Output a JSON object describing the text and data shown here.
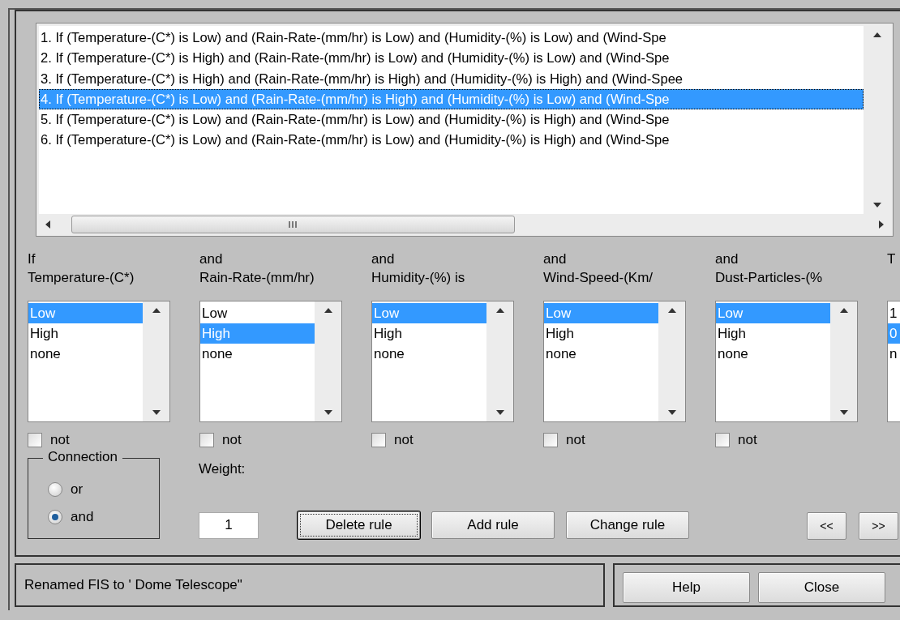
{
  "rules": [
    {
      "text": "1. If (Temperature-(C*) is Low) and (Rain-Rate-(mm/hr) is Low) and (Humidity-(%) is Low) and (Wind-Spe",
      "selected": false
    },
    {
      "text": "2. If (Temperature-(C*) is High) and (Rain-Rate-(mm/hr) is Low) and (Humidity-(%) is Low) and (Wind-Spe",
      "selected": false
    },
    {
      "text": "3. If (Temperature-(C*) is High) and (Rain-Rate-(mm/hr) is High) and (Humidity-(%) is High) and (Wind-Spee",
      "selected": false
    },
    {
      "text": "4. If (Temperature-(C*) is Low) and (Rain-Rate-(mm/hr) is High) and (Humidity-(%) is Low) and (Wind-Spe",
      "selected": true
    },
    {
      "text": "5. If (Temperature-(C*) is Low) and (Rain-Rate-(mm/hr) is Low) and (Humidity-(%) is High) and (Wind-Spe",
      "selected": false
    },
    {
      "text": "6. If (Temperature-(C*) is Low) and (Rain-Rate-(mm/hr) is Low) and (Humidity-(%) is High) and (Wind-Spe",
      "selected": false
    }
  ],
  "columns": [
    {
      "kind": "input",
      "prefix": "If",
      "variable": "Temperature-(C*)",
      "options": [
        {
          "label": "Low",
          "selected": true
        },
        {
          "label": "High",
          "selected": false
        },
        {
          "label": "none",
          "selected": false
        }
      ],
      "not_label": "not",
      "not": false
    },
    {
      "kind": "input",
      "prefix": "and",
      "variable": "Rain-Rate-(mm/hr)",
      "options": [
        {
          "label": "Low",
          "selected": false
        },
        {
          "label": "High",
          "selected": true
        },
        {
          "label": "none",
          "selected": false
        }
      ],
      "not_label": "not",
      "not": false
    },
    {
      "kind": "input",
      "prefix": "and",
      "variable": "Humidity-(%) is",
      "options": [
        {
          "label": "Low",
          "selected": true
        },
        {
          "label": "High",
          "selected": false
        },
        {
          "label": "none",
          "selected": false
        }
      ],
      "not_label": "not",
      "not": false
    },
    {
      "kind": "input",
      "prefix": "and",
      "variable": "Wind-Speed-(Km/",
      "options": [
        {
          "label": "Low",
          "selected": true
        },
        {
          "label": "High",
          "selected": false
        },
        {
          "label": "none",
          "selected": false
        }
      ],
      "not_label": "not",
      "not": false
    },
    {
      "kind": "input",
      "prefix": "and",
      "variable": "Dust-Particles-(%",
      "options": [
        {
          "label": "Low",
          "selected": true
        },
        {
          "label": "High",
          "selected": false
        },
        {
          "label": "none",
          "selected": false
        }
      ],
      "not_label": "not",
      "not": false
    },
    {
      "kind": "partial",
      "prefix": "T",
      "options": [
        {
          "label": "1",
          "selected": false
        },
        {
          "label": "0",
          "selected": true
        },
        {
          "label": "n",
          "selected": false
        }
      ]
    }
  ],
  "connection": {
    "title": "Connection",
    "options": [
      {
        "label": "or",
        "selected": false
      },
      {
        "label": "and",
        "selected": true
      }
    ]
  },
  "weight": {
    "label": "Weight:",
    "value": "1"
  },
  "buttons": [
    {
      "label": "Delete rule",
      "focused": true
    },
    {
      "label": "Add rule",
      "focused": false
    },
    {
      "label": "Change rule",
      "focused": false
    }
  ],
  "nav_buttons": [
    "<<",
    ">>"
  ],
  "status": "Renamed FIS to ' Dome Telescope\"",
  "footer_buttons": [
    "Help",
    "Close"
  ]
}
